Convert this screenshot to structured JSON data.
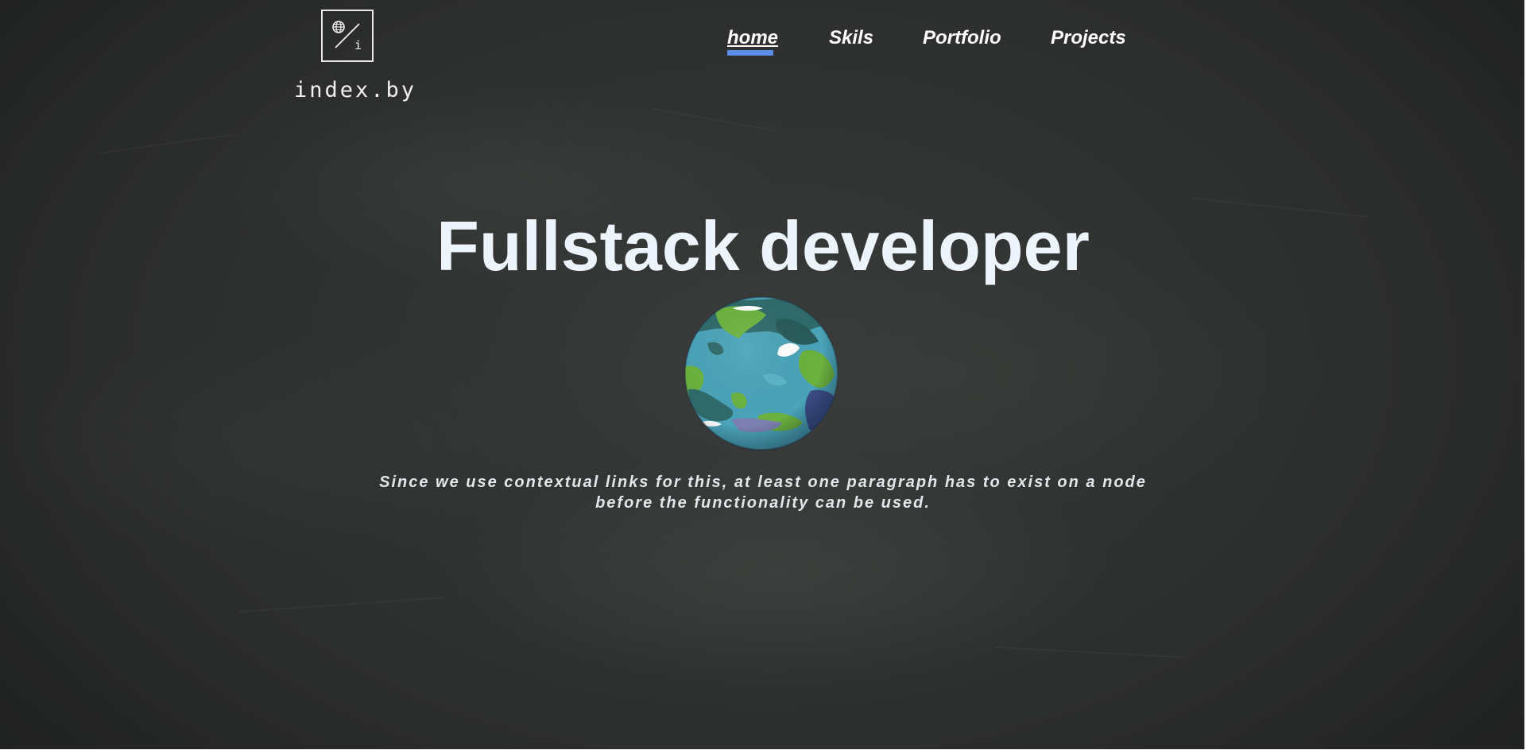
{
  "site": {
    "logo_text": "index.by",
    "logo_icon_letter": "i"
  },
  "nav": {
    "items": [
      {
        "label": "home",
        "active": true
      },
      {
        "label": "Skils",
        "active": false
      },
      {
        "label": "Portfolio",
        "active": false
      },
      {
        "label": "Projects",
        "active": false
      }
    ]
  },
  "hero": {
    "title": "Fullstack developer",
    "paragraph": "Since we use contextual links for this, at least one paragraph has to exist on a node before the functionality can be used."
  },
  "icons": {
    "logo": "globe-slash-i-logo-icon",
    "hero_image": "planet-globe-icon"
  },
  "colors": {
    "background": "#2f3130",
    "text": "#ffffff",
    "title": "#eef4fb",
    "accent": "#5b8de8"
  }
}
